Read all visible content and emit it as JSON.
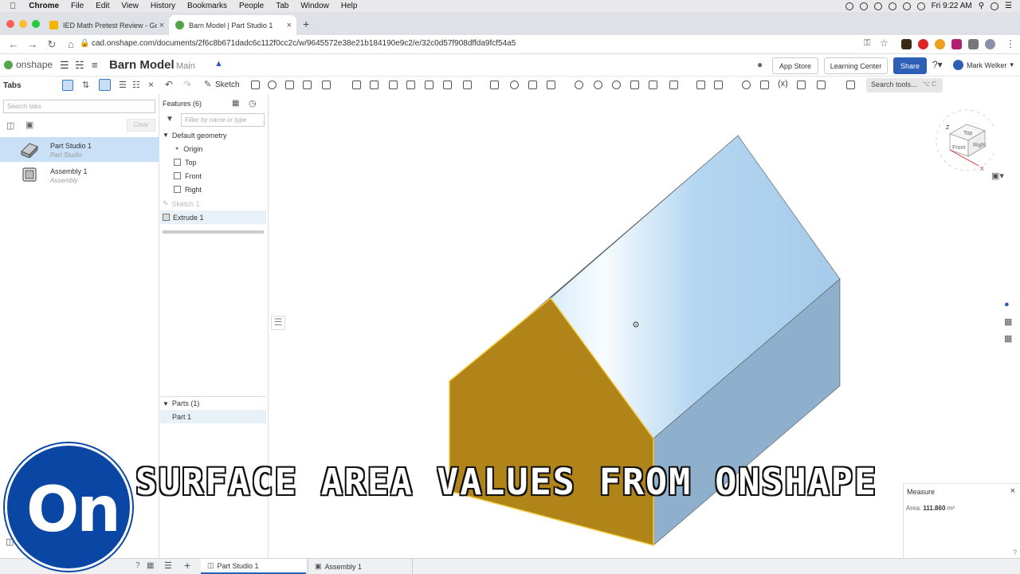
{
  "mac_menubar": {
    "items": [
      "Chrome",
      "File",
      "Edit",
      "View",
      "History",
      "Bookmarks",
      "People",
      "Tab",
      "Window",
      "Help"
    ],
    "clock": "Fri 9:22 AM"
  },
  "browser": {
    "tabs": [
      {
        "title": "IED Math Pretest Review - Goo",
        "active": false
      },
      {
        "title": "Barn Model | Part Studio 1",
        "active": true
      }
    ],
    "url": "cad.onshape.com/documents/2f6c8b671dadc6c112f0cc2c/w/9645572e38e21b184190e9c2/e/32c0d57f908dffda9fcf54a5"
  },
  "onshape": {
    "logo_text": "onshape",
    "document_name": "Barn Model",
    "branch": "Main",
    "header_buttons": {
      "app_store": "App Store",
      "learning_center": "Learning Center",
      "share": "Share"
    },
    "user_name": "Mark Welker",
    "toolbar": {
      "tabs_label": "Tabs",
      "sketch_label": "Sketch",
      "search_tools": "Search tools...",
      "search_shortcut": "⌥ C"
    }
  },
  "tab_panel": {
    "search_placeholder": "Search tabs",
    "clear_label": "Clear",
    "items": [
      {
        "name": "Part Studio 1",
        "type": "Part Studio",
        "selected": true
      },
      {
        "name": "Assembly 1",
        "type": "Assembly",
        "selected": false
      }
    ]
  },
  "feature_panel": {
    "header": "Features (6)",
    "filter_placeholder": "Filter by name or type",
    "default_geometry": "Default geometry",
    "geometry_items": [
      "Origin",
      "Top",
      "Front",
      "Right"
    ],
    "features": [
      "Sketch 1",
      "Extrude 1"
    ],
    "parts_header": "Parts (1)",
    "parts": [
      "Part 1"
    ]
  },
  "view_cube": {
    "top": "Top",
    "front": "Front",
    "right": "Right",
    "axis_z": "Z",
    "axis_x": "X"
  },
  "bottom_tabs": [
    {
      "label": "Part Studio 1",
      "active": true
    },
    {
      "label": "Assembly 1",
      "active": false
    }
  ],
  "measure": {
    "title": "Measure",
    "area_label": "Area:",
    "area_value": "111.860",
    "area_unit": "m²"
  },
  "overlay": {
    "logo_text": "On",
    "caption": "SURFACE AREA VALUES FROM ONSHAPE"
  },
  "colors": {
    "accent_blue": "#2d5fb7",
    "roof_blue": "#b4d4ee",
    "side_blue": "#8fb0cc",
    "gable_gold": "#b08419",
    "logo_blue": "#0a47a5"
  }
}
